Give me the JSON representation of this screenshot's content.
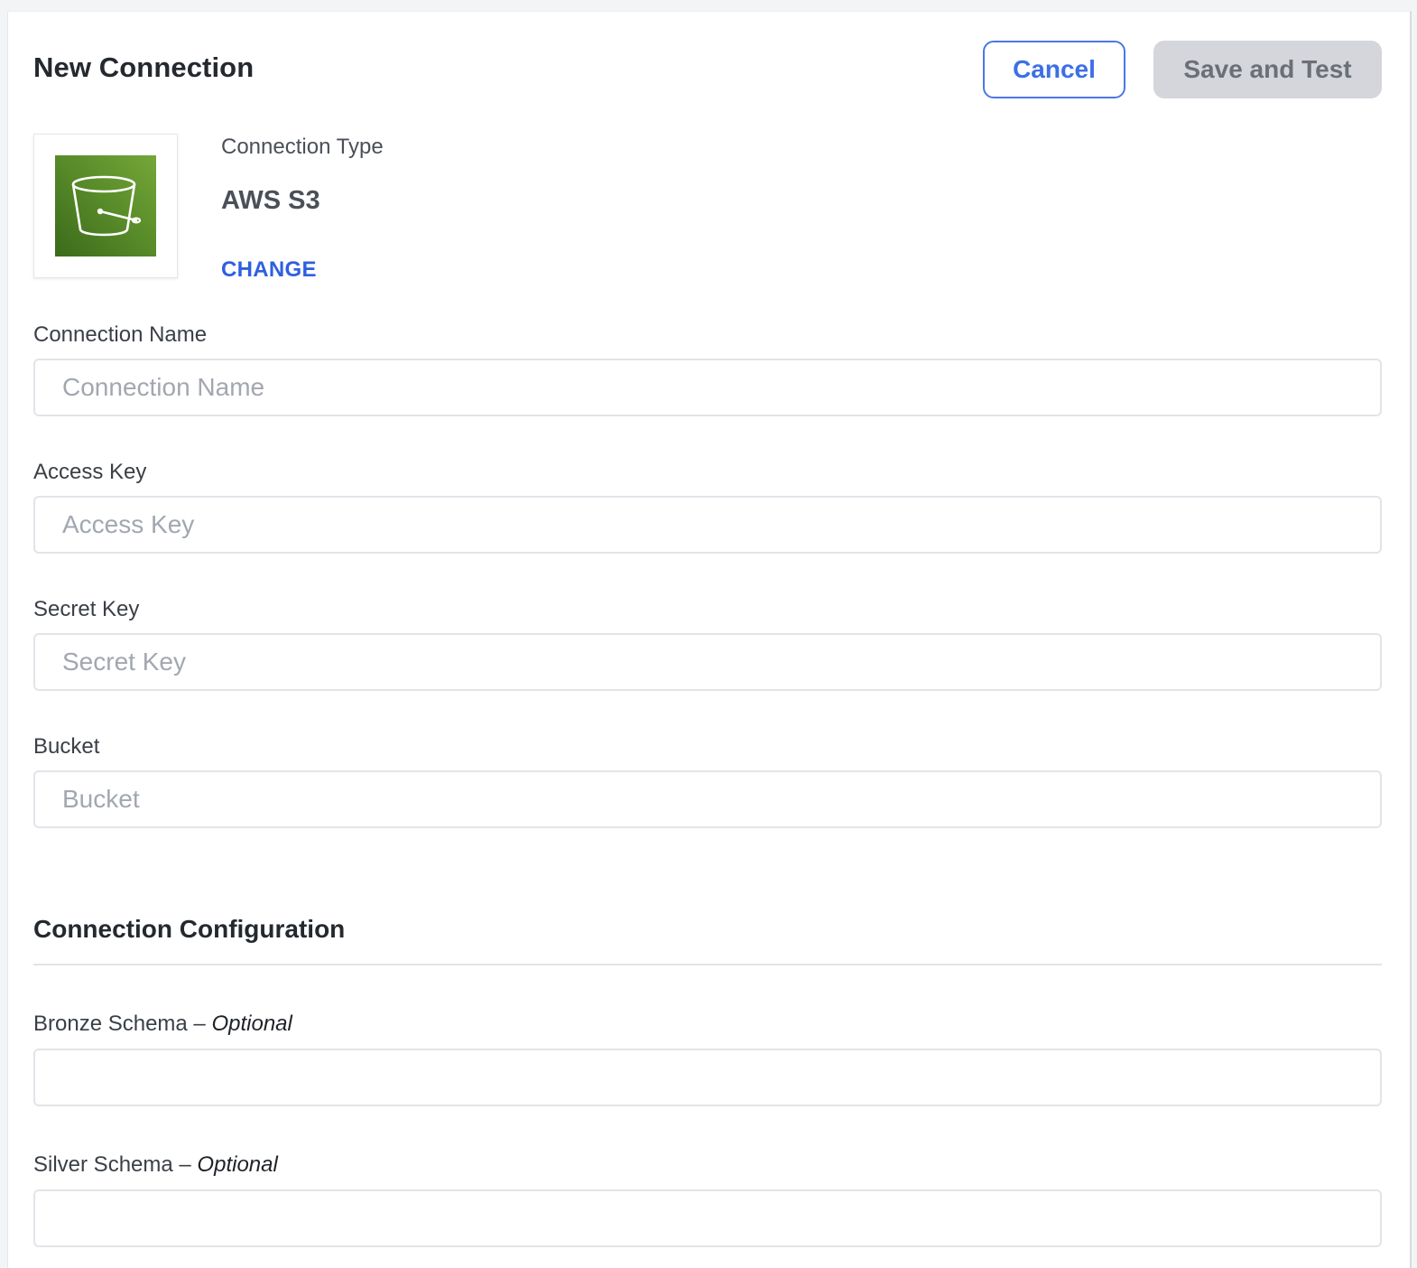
{
  "header": {
    "title": "New Connection",
    "cancel_label": "Cancel",
    "save_label": "Save and Test"
  },
  "connection_type": {
    "label": "Connection Type",
    "value": "AWS S3",
    "change_label": "CHANGE",
    "icon": "s3-bucket-icon",
    "icon_color": "#5a8d2a"
  },
  "fields": {
    "connection_name": {
      "label": "Connection Name",
      "placeholder": "Connection Name",
      "value": ""
    },
    "access_key": {
      "label": "Access Key",
      "placeholder": "Access Key",
      "value": ""
    },
    "secret_key": {
      "label": "Secret Key",
      "placeholder": "Secret Key",
      "value": ""
    },
    "bucket": {
      "label": "Bucket",
      "placeholder": "Bucket",
      "value": ""
    }
  },
  "configuration": {
    "title": "Connection Configuration",
    "bronze_schema": {
      "label": "Bronze Schema",
      "optional": "Optional",
      "value": ""
    },
    "silver_schema": {
      "label": "Silver Schema",
      "optional": "Optional",
      "value": ""
    }
  },
  "colors": {
    "accent": "#3d6fe6",
    "link": "#2f5fe0",
    "disabled_button": "#d4d6db"
  }
}
